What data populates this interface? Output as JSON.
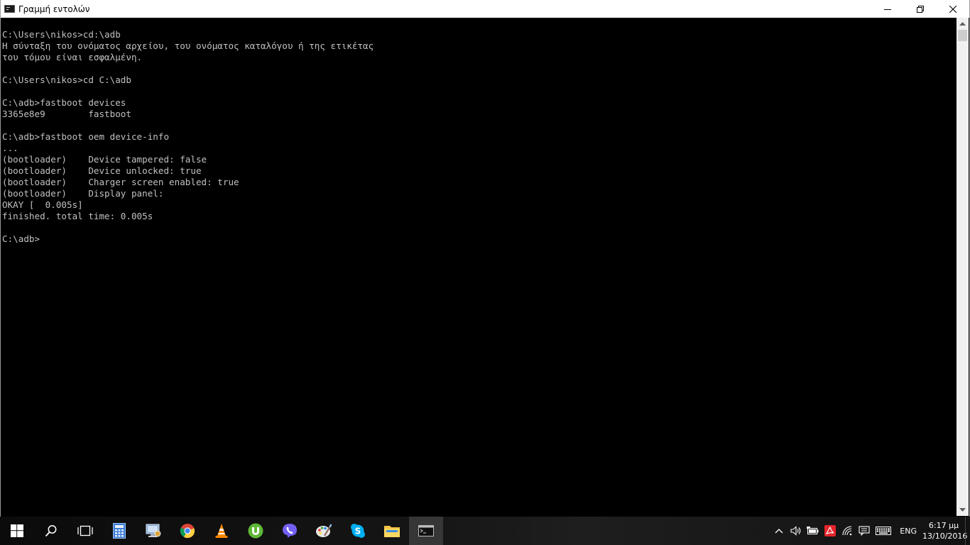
{
  "window": {
    "title": "Γραμμή εντολών",
    "controls": {
      "minimize": "minimize",
      "maximize": "restore",
      "close": "close"
    }
  },
  "console": {
    "lines": [
      "C:\\Users\\nikos>cd:\\adb",
      "Η σύνταξη του ονόματος αρχείου, του ονόματος καταλόγου ή της ετικέτας",
      "του τόμου είναι εσφαλμένη.",
      "",
      "C:\\Users\\nikos>cd C:\\adb",
      "",
      "C:\\adb>fastboot devices",
      "3365e8e9        fastboot",
      "",
      "C:\\adb>fastboot oem device-info",
      "...",
      "(bootloader)    Device tampered: false",
      "(bootloader)    Device unlocked: true",
      "(bootloader)    Charger screen enabled: true",
      "(bootloader)    Display panel:",
      "OKAY [  0.005s]",
      "finished. total time: 0.005s",
      "",
      "C:\\adb>"
    ],
    "text_color": "#c0c0c0",
    "background": "#000000"
  },
  "taskbar": {
    "items": [
      {
        "icon": "windows-start-icon",
        "state": "none"
      },
      {
        "icon": "search-icon",
        "state": "none"
      },
      {
        "icon": "task-view-icon",
        "state": "none"
      },
      {
        "icon": "calculator-icon",
        "state": "pinned"
      },
      {
        "icon": "control-panel-icon",
        "state": "pinned"
      },
      {
        "icon": "chrome-icon",
        "state": "pinned"
      },
      {
        "icon": "vlc-icon",
        "state": "pinned"
      },
      {
        "icon": "utorrent-icon",
        "state": "running"
      },
      {
        "icon": "viber-icon",
        "state": "running"
      },
      {
        "icon": "paint-icon",
        "state": "running"
      },
      {
        "icon": "skype-icon",
        "state": "running"
      },
      {
        "icon": "file-explorer-icon",
        "state": "running"
      },
      {
        "icon": "command-prompt-icon",
        "state": "active"
      }
    ],
    "tray": {
      "icons": [
        "chevron-up-icon",
        "volume-icon",
        "battery-icon",
        "acrobat-icon",
        "wifi-icon",
        "notification-icon",
        "keyboard-icon"
      ],
      "language": "ENG",
      "time": "6:17 μμ",
      "date": "13/10/2016"
    },
    "accent_color": "#76b9ed"
  }
}
